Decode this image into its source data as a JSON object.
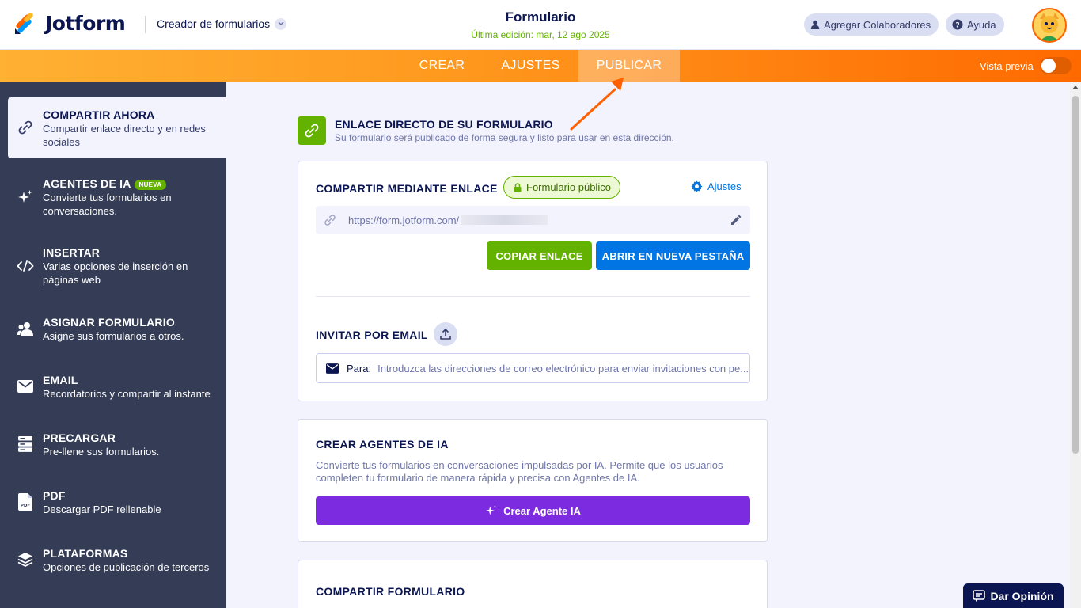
{
  "brand": {
    "name": "Jotform"
  },
  "header": {
    "builder_menu": "Creador de formularios",
    "form_title": "Formulario",
    "last_edit": "Última edición: mar, 12 ago 2025",
    "collaborators_label": "Agregar Colaboradores",
    "help_label": "Ayuda"
  },
  "nav": {
    "tabs": [
      {
        "label": "CREAR"
      },
      {
        "label": "AJUSTES"
      },
      {
        "label": "PUBLICAR",
        "active": true
      }
    ],
    "preview_label": "Vista previa",
    "preview_on": false
  },
  "sidebar": {
    "items": [
      {
        "title": "COMPARTIR AHORA",
        "desc": "Compartir enlace directo y en redes sociales",
        "icon": "link-icon",
        "active": true
      },
      {
        "title": "AGENTES DE IA",
        "badge": "NUEVA",
        "desc": "Convierte tus formularios en conversaciones.",
        "icon": "sparkle-icon"
      },
      {
        "title": "INSERTAR",
        "desc": "Varias opciones de inserción en páginas web",
        "icon": "code-icon"
      },
      {
        "title": "ASIGNAR FORMULARIO",
        "desc": "Asigne sus formularios a otros.",
        "icon": "users-icon"
      },
      {
        "title": "EMAIL",
        "desc": "Recordatorios y compartir al instante",
        "icon": "envelope-icon"
      },
      {
        "title": "PRECARGAR",
        "desc": "Pre-llene sus formularios.",
        "icon": "database-icon"
      },
      {
        "title": "PDF",
        "desc": "Descargar PDF rellenable",
        "icon": "pdf-file-icon"
      },
      {
        "title": "PLATAFORMAS",
        "desc": "Opciones de publicación de terceros",
        "icon": "layers-icon"
      }
    ]
  },
  "main": {
    "direct_link_title": "ENLACE DIRECTO DE SU FORMULARIO",
    "direct_link_sub": "Su formulario será publicado de forma segura y listo para usar en esta dirección.",
    "share_card": {
      "title": "COMPARTIR MEDIANTE ENLACE",
      "public_badge": "Formulario público",
      "settings_label": "Ajustes",
      "url": "https://form.jotform.com/",
      "copy_button": "COPIAR ENLACE",
      "open_button": "ABRIR EN NUEVA PESTAÑA",
      "invite_title": "INVITAR POR EMAIL",
      "to_label": "Para:",
      "email_placeholder": "Introduzca las direcciones de correo electrónico para enviar invitaciones con pe..."
    },
    "ai_card": {
      "title": "CREAR AGENTES DE IA",
      "desc": "Convierte tus formularios en conversaciones impulsadas por IA. Permite que los usuarios completen tu formulario de manera rápida y precisa con Agentes de IA.",
      "button": "Crear Agente IA"
    },
    "share_form_card": {
      "title": "COMPARTIR FORMULARIO"
    }
  },
  "feedback": {
    "label": "Dar Opinión"
  },
  "colors": {
    "brand_orange": "#ff6100",
    "sidebar_bg": "#343c56",
    "green": "#64b200",
    "blue": "#0075e3",
    "purple": "#7c2be0",
    "navy": "#0a1551"
  }
}
